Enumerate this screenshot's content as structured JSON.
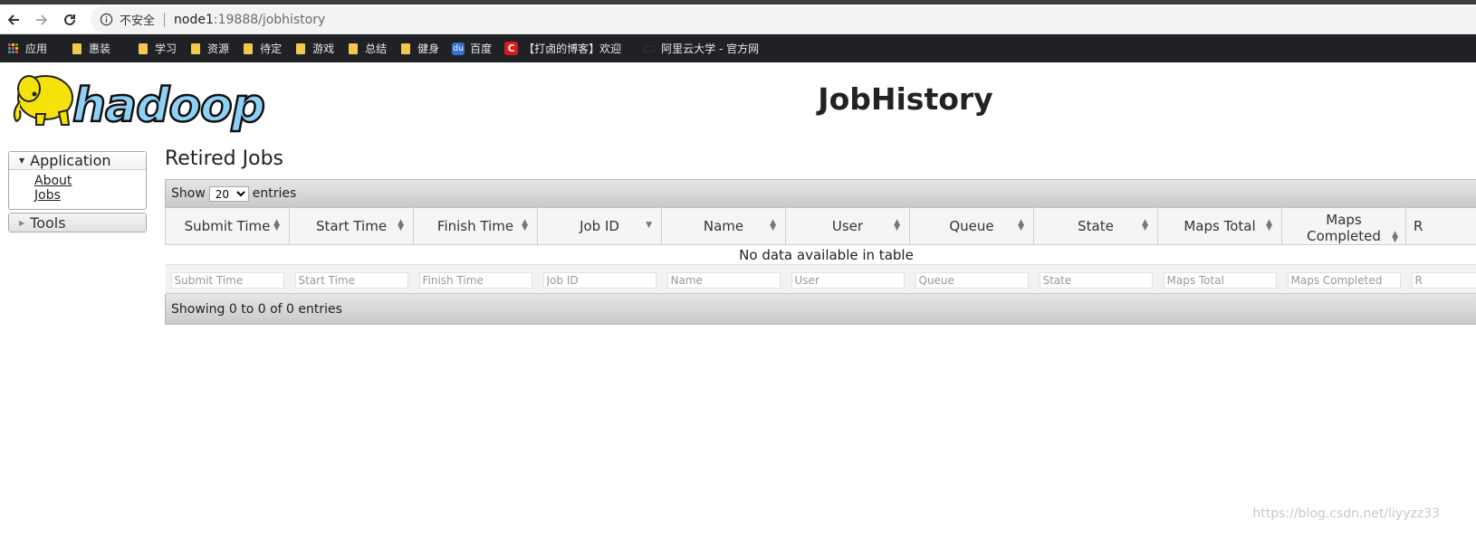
{
  "browser": {
    "security_label": "不安全",
    "url_host": "node1",
    "url_rest": ":19888/jobhistory",
    "bookmarks": [
      {
        "label": "应用",
        "icon": "apps-grid-icon"
      },
      {
        "label": "惠装",
        "icon": "folder-icon"
      },
      {
        "label": "学习",
        "icon": "folder-icon"
      },
      {
        "label": "资源",
        "icon": "folder-icon"
      },
      {
        "label": "待定",
        "icon": "folder-icon"
      },
      {
        "label": "游戏",
        "icon": "folder-icon"
      },
      {
        "label": "总结",
        "icon": "folder-icon"
      },
      {
        "label": "健身",
        "icon": "folder-icon"
      },
      {
        "label": "百度",
        "icon": "baidu-icon"
      },
      {
        "label": "【打卤的博客】欢迎",
        "icon": "csdn-icon"
      },
      {
        "label": "阿里云大学 - 官方网",
        "icon": "aliyun-icon"
      }
    ]
  },
  "header": {
    "logo_text": "hadoop",
    "title": "JobHistory"
  },
  "sidebar": {
    "application": {
      "label": "Application",
      "links": [
        "About",
        "Jobs"
      ]
    },
    "tools": {
      "label": "Tools"
    }
  },
  "main": {
    "section_title": "Retired Jobs",
    "show_label": "Show",
    "entries_label": "entries",
    "page_size": "20",
    "columns": [
      "Submit Time",
      "Start Time",
      "Finish Time",
      "Job ID",
      "Name",
      "User",
      "Queue",
      "State",
      "Maps Total",
      "Maps Completed",
      "R"
    ],
    "empty_message": "No data available in table",
    "filter_placeholders": [
      "Submit Time",
      "Start Time",
      "Finish Time",
      "Job ID",
      "Name",
      "User",
      "Queue",
      "State",
      "Maps Total",
      "Maps Completed",
      "R"
    ],
    "info_text": "Showing 0 to 0 of 0 entries"
  },
  "watermark": "https://blog.csdn.net/liyyzz33",
  "colors": {
    "chrome_dark": "#202124",
    "folder": "#f2c94c",
    "logo_blue": "#8fd0f5",
    "logo_yellow": "#f5e20a"
  }
}
